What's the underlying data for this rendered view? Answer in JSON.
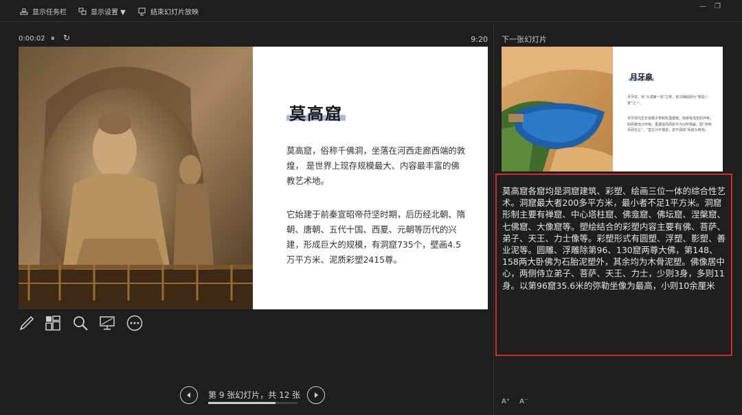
{
  "toolbar": {
    "taskbar_label": "显示任务栏",
    "display_settings_label": "显示设置 ▼",
    "end_show_label": "结束幻灯片放映"
  },
  "window": {
    "minimize": "—",
    "restore": "❐"
  },
  "presenter": {
    "elapsed_time": "0:00:02",
    "clock": "9:20"
  },
  "current_slide": {
    "title": "莫高窟",
    "paragraphs": [
      "莫高窟，俗称千佛洞，坐落在河西走廊西端的敦煌， 是世界上现存规模最大、内容最丰富的佛教艺术地。",
      "它始建于前秦宣昭帝苻坚时期，后历经北朝、隋朝、唐朝、五代十国、西夏、元朝等历代的兴建，形成巨大的规模，有洞窟735个，壁画4.5万平方米、泥质彩塑2415尊。"
    ]
  },
  "next_slide": {
    "label": "下一张幻灯片",
    "title": "月牙泉",
    "paragraphs": [
      "月牙泉，有“沙漠第一泉”之称，自汉朝起即为“敦煌八景”之一。",
      "月牙泉内生长有眼子草和轮藻植物，南岸有茂密的芦苇，四周被流沙环抱，虽遇强风而泉不为沙所掩盖，因“泉映月而无尘”，“亘古沙不填泉，泉不涸竭”而成为奇观。"
    ]
  },
  "notes": {
    "text": "莫高窟各窟均是洞窟建筑、彩塑、绘画三位一体的综合性艺术。洞窟最大者200多平方米，最小者不足1平方米。洞窟形制主要有禅窟、中心塔柱窟、佛龛窟、佛坛窟、涅槃窟、七佛窟、大像窟等。塑绘结合的彩塑内容主要有佛、菩萨、弟子、天王、力士像等。彩塑形式有圆塑、浮塑、影塑、善业泥等。圆雕、浮雕除第96、130窟两尊大佛，第148、158两大卧佛为石胎泥塑外，其余均为木骨泥塑。佛像居中心，两侧侍立弟子、菩萨、天王、力士，少则3身，多则11身。以第96窟35.6米的弥勒坐像为最高，小则10余厘米"
  },
  "font_controls": {
    "increase": "A⁺",
    "decrease": "A⁻"
  },
  "navigation": {
    "counter": "第 9 张幻灯片，共 12 张",
    "current": 9,
    "total": 12,
    "progress": 0.75
  },
  "icons": {
    "taskbar": "taskbar-icon",
    "display": "display-settings-icon",
    "end_show": "end-show-icon",
    "pen": "pen-icon",
    "all_slides": "all-slides-icon",
    "zoom": "zoom-icon",
    "screen": "screen-icon",
    "more": "more-options-icon",
    "prev": "prev-arrow-icon",
    "next": "next-arrow-icon"
  },
  "colors": {
    "background": "#1e1e1e",
    "notes_border": "#d42a2a",
    "title_highlight": "#a9b8de"
  }
}
